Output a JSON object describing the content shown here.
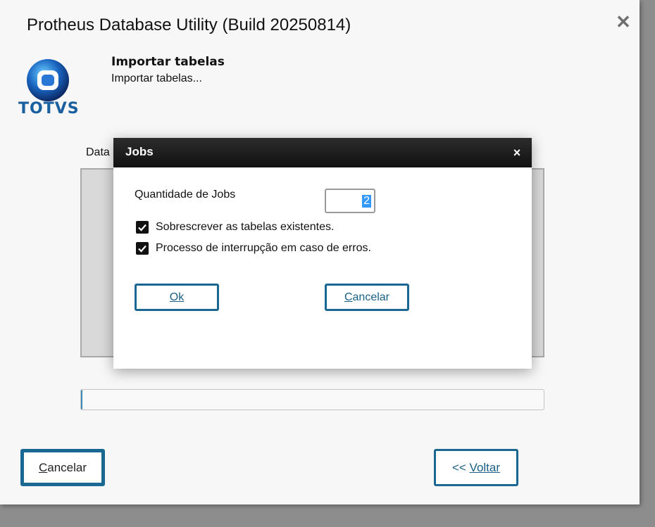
{
  "window": {
    "title": "Protheus Database Utility (Build 20250814)",
    "close_icon": "close-icon"
  },
  "logo": {
    "text": "TOTVS",
    "icon": "totvs-logo"
  },
  "step": {
    "title": "Importar tabelas",
    "subtitle": "Importar tabelas..."
  },
  "data_label": "Data",
  "footer": {
    "cancel_prefix": "",
    "cancel_hotkey": "C",
    "cancel_rest": "ancelar",
    "back_prefix": "<< ",
    "back_hotkey": "V",
    "back_rest": "oltar"
  },
  "dialog": {
    "title": "Jobs",
    "close_glyph": "×",
    "jobs_label": "Quantidade de Jobs",
    "jobs_value": "2",
    "checkboxes": [
      {
        "label": "Sobrescrever as tabelas existentes.",
        "checked": true
      },
      {
        "label": "Processo de interrupção em caso de erros.",
        "checked": true
      }
    ],
    "ok_hotkey": "O",
    "ok_rest": "k",
    "cancel_hotkey": "C",
    "cancel_rest": "ancelar"
  },
  "colors": {
    "accent": "#1a6891",
    "selection": "#3399ff",
    "header_dark": "#111111"
  }
}
